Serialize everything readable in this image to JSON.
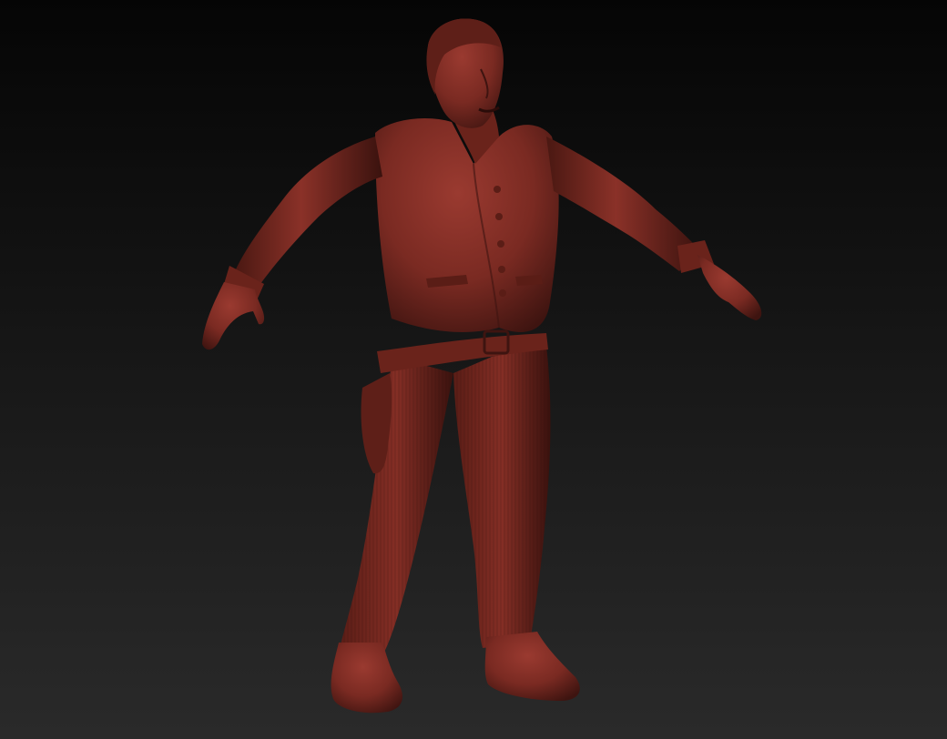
{
  "viewport": {
    "background_top": "#050505",
    "background_bottom": "#2a2a2a"
  },
  "model": {
    "material_base": "#7a2a22",
    "material_light": "#9a3a30",
    "material_shadow": "#3e1410",
    "material_dark": "#2a0c09"
  }
}
